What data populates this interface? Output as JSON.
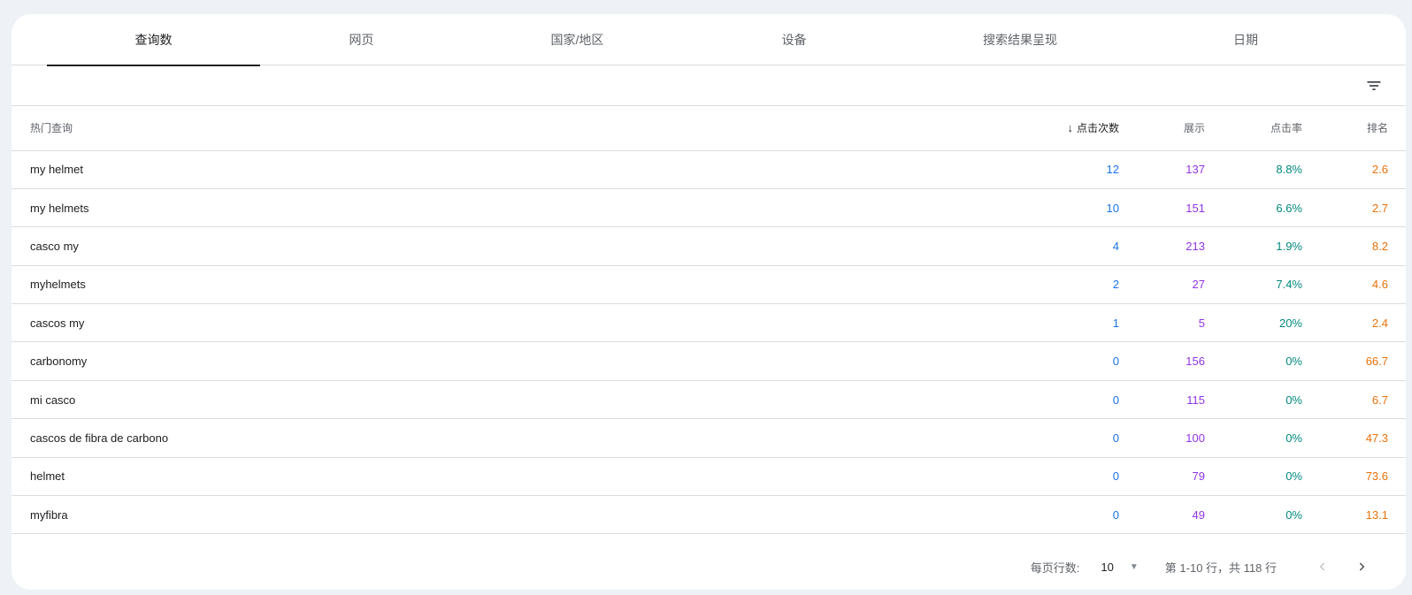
{
  "tabs": [
    {
      "label": "查询数"
    },
    {
      "label": "网页"
    },
    {
      "label": "国家/地区"
    },
    {
      "label": "设备"
    },
    {
      "label": "搜索结果呈现"
    },
    {
      "label": "日期"
    }
  ],
  "filter": {
    "icon": "filter-icon"
  },
  "table": {
    "headers": {
      "query": "热门查询",
      "clicks": "点击次数",
      "impressions": "展示",
      "ctr": "点击率",
      "position": "排名"
    },
    "sort_icon": "arrow-down-icon",
    "rows": [
      {
        "query": "my helmet",
        "clicks": "12",
        "impressions": "137",
        "ctr": "8.8%",
        "position": "2.6"
      },
      {
        "query": "my helmets",
        "clicks": "10",
        "impressions": "151",
        "ctr": "6.6%",
        "position": "2.7"
      },
      {
        "query": "casco my",
        "clicks": "4",
        "impressions": "213",
        "ctr": "1.9%",
        "position": "8.2"
      },
      {
        "query": "myhelmets",
        "clicks": "2",
        "impressions": "27",
        "ctr": "7.4%",
        "position": "4.6"
      },
      {
        "query": "cascos my",
        "clicks": "1",
        "impressions": "5",
        "ctr": "20%",
        "position": "2.4"
      },
      {
        "query": "carbonomy",
        "clicks": "0",
        "impressions": "156",
        "ctr": "0%",
        "position": "66.7"
      },
      {
        "query": "mi casco",
        "clicks": "0",
        "impressions": "115",
        "ctr": "0%",
        "position": "6.7"
      },
      {
        "query": "cascos de fibra de carbono",
        "clicks": "0",
        "impressions": "100",
        "ctr": "0%",
        "position": "47.3"
      },
      {
        "query": "helmet",
        "clicks": "0",
        "impressions": "79",
        "ctr": "0%",
        "position": "73.6"
      },
      {
        "query": "myfibra",
        "clicks": "0",
        "impressions": "49",
        "ctr": "0%",
        "position": "13.1"
      }
    ]
  },
  "pagination": {
    "rows_per_page_label": "每页行数:",
    "rows_per_page_value": "10",
    "range_text": "第 1-10 行，共 118 行"
  },
  "colors": {
    "clicks": "#1a73e8",
    "impressions": "#9334e6",
    "ctr": "#00897b",
    "position": "#e8710a"
  }
}
